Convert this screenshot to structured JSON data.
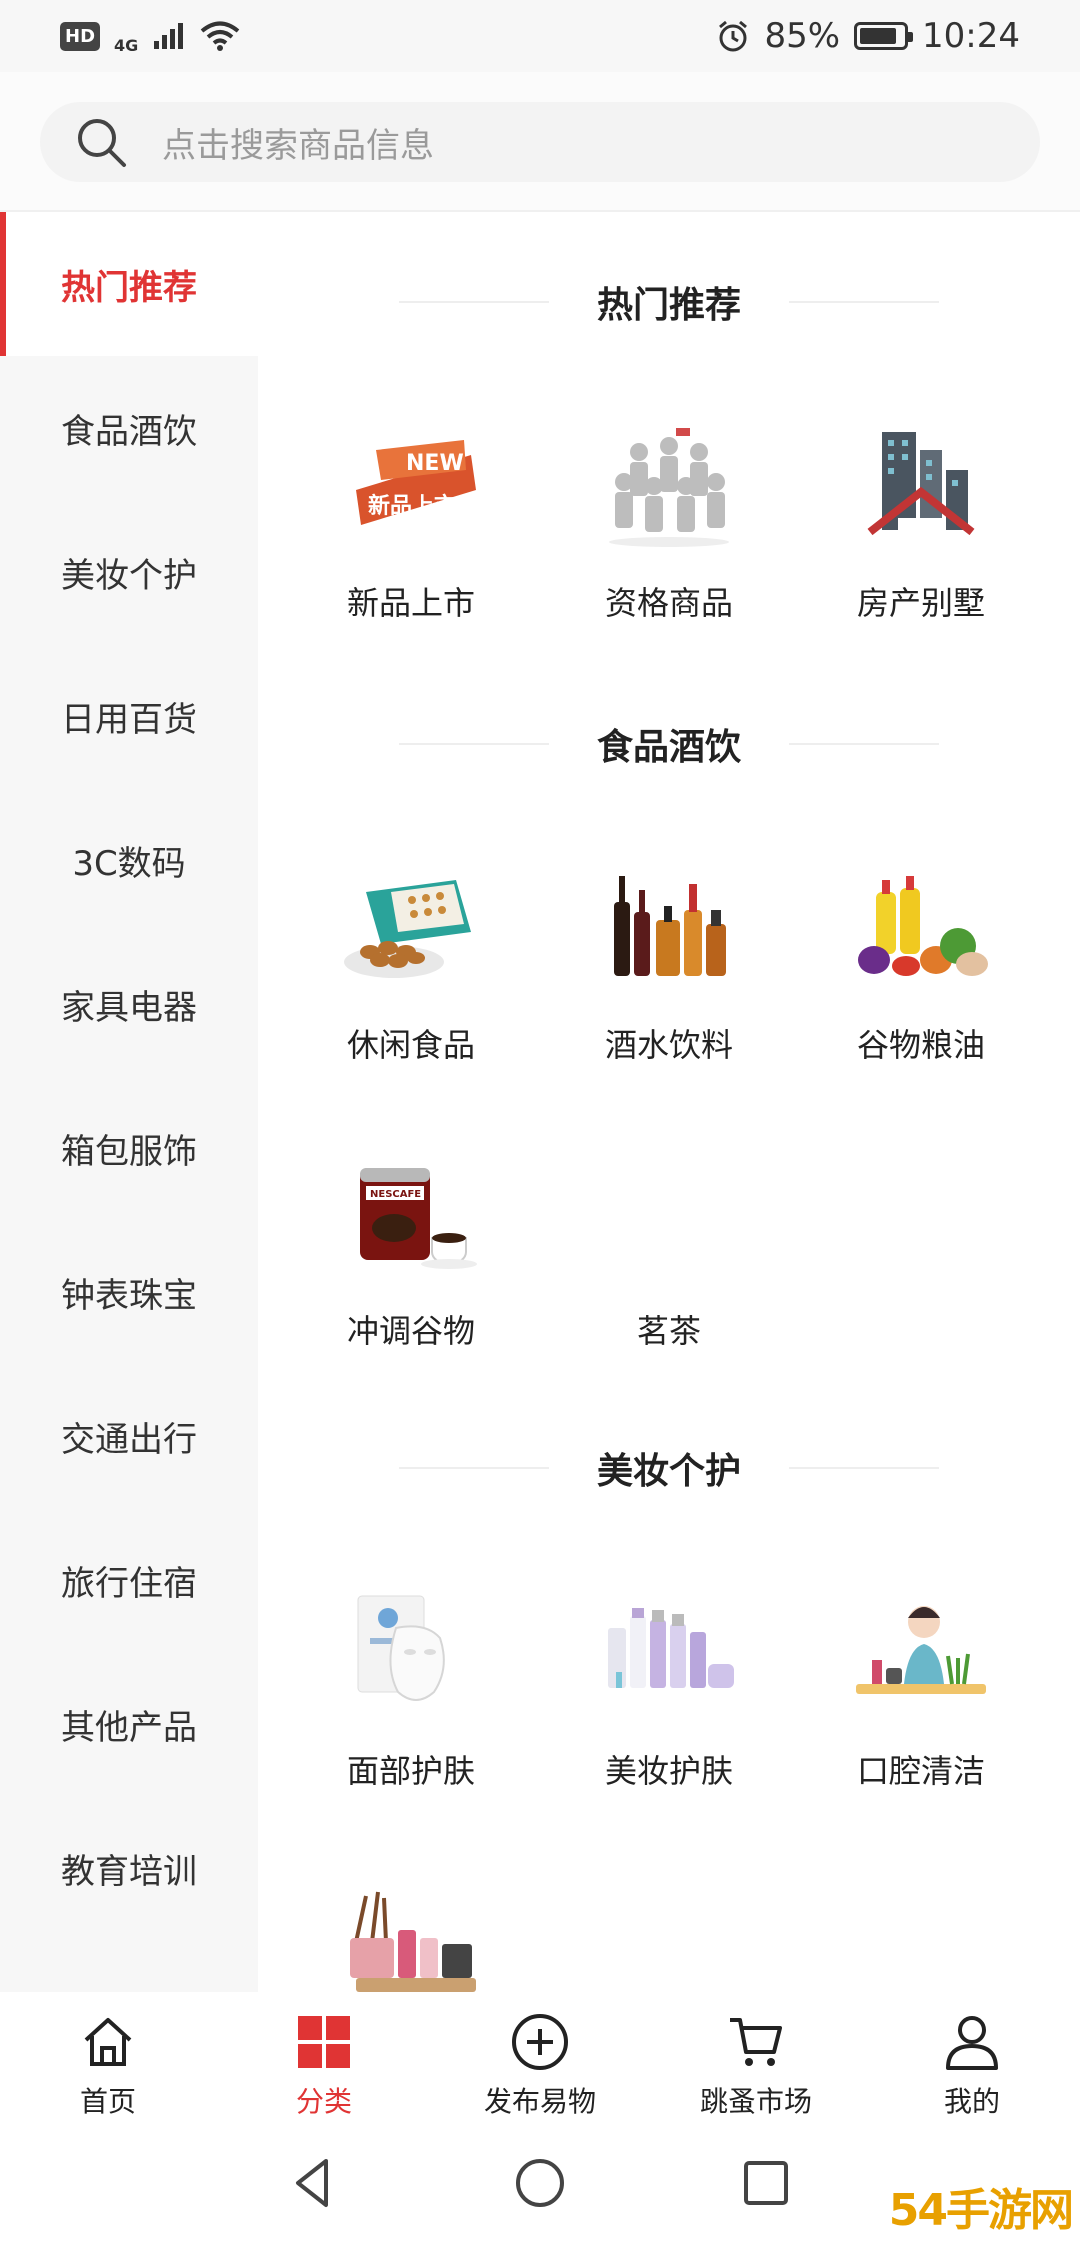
{
  "status_bar": {
    "hd": "HD",
    "network": "4G",
    "battery": "85%",
    "battery_level": 0.85,
    "time": "10:24"
  },
  "search": {
    "placeholder": "点击搜索商品信息"
  },
  "sidebar": {
    "items": [
      {
        "label": "热门推荐",
        "active": true
      },
      {
        "label": "食品酒饮"
      },
      {
        "label": "美妆个护"
      },
      {
        "label": "日用百货"
      },
      {
        "label": "3C数码"
      },
      {
        "label": "家具电器"
      },
      {
        "label": "箱包服饰"
      },
      {
        "label": "钟表珠宝"
      },
      {
        "label": "交通出行"
      },
      {
        "label": "旅行住宿"
      },
      {
        "label": "其他产品"
      },
      {
        "label": "教育培训"
      }
    ]
  },
  "sections": [
    {
      "title": "热门推荐",
      "items": [
        {
          "label": "新品上市",
          "icon": "new-arrival-image"
        },
        {
          "label": "资格商品",
          "icon": "business-people-image"
        },
        {
          "label": "房产别墅",
          "icon": "buildings-image"
        }
      ]
    },
    {
      "title": "食品酒饮",
      "items": [
        {
          "label": "休闲食品",
          "icon": "snack-box-image"
        },
        {
          "label": "酒水饮料",
          "icon": "wine-bottles-image"
        },
        {
          "label": "谷物粮油",
          "icon": "oil-vegetables-image"
        },
        {
          "label": "冲调谷物",
          "icon": "coffee-can-image"
        },
        {
          "label": "茗茶",
          "icon": ""
        }
      ]
    },
    {
      "title": "美妆个护",
      "items": [
        {
          "label": "面部护肤",
          "icon": "face-mask-image"
        },
        {
          "label": "美妆护肤",
          "icon": "cosmetics-bottles-image"
        },
        {
          "label": "口腔清洁",
          "icon": "dental-care-image"
        },
        {
          "label": "",
          "icon": "makeup-brushes-image"
        }
      ]
    }
  ],
  "bottom_nav": [
    {
      "label": "首页",
      "icon": "home-icon"
    },
    {
      "label": "分类",
      "icon": "category-grid-icon",
      "active": true
    },
    {
      "label": "发布易物",
      "icon": "plus-circle-icon"
    },
    {
      "label": "跳蚤市场",
      "icon": "cart-icon"
    },
    {
      "label": "我的",
      "icon": "user-icon"
    }
  ],
  "colors": {
    "accent": "#e03434",
    "sidebar_bg": "#f7f7f7",
    "text": "#222222"
  },
  "watermark": "54手游网"
}
